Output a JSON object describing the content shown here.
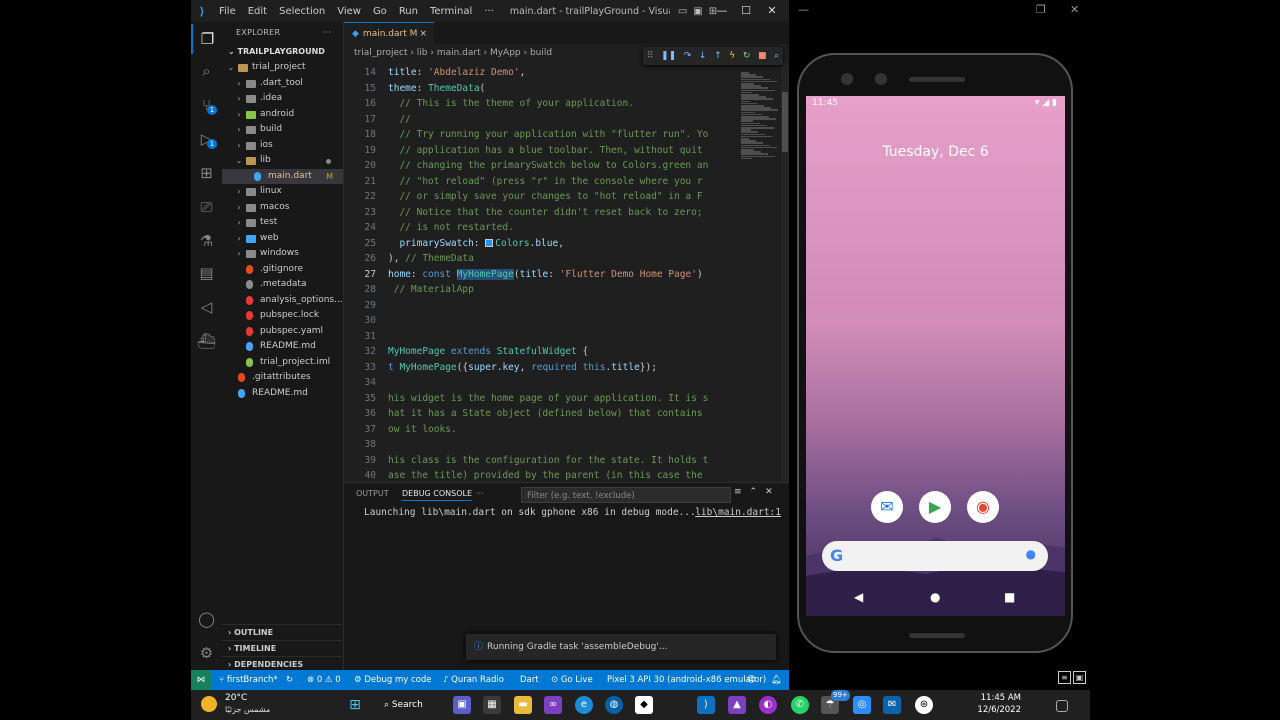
{
  "vscode": {
    "menu": [
      "File",
      "Edit",
      "Selection",
      "View",
      "Go",
      "Run",
      "Terminal",
      "···"
    ],
    "window_title": "main.dart - trailPlayGround - Visual Studi...",
    "explorer_title": "EXPLORER",
    "explorer_more": "···",
    "workspace": "TRAILPLAYGROUND",
    "tree": [
      {
        "label": "trial_project",
        "depth": 1,
        "chev": "⌄",
        "color": "#c09553",
        "kind": "folder"
      },
      {
        "label": ".dart_tool",
        "depth": 2,
        "chev": "›",
        "color": "#8a8a8a",
        "kind": "folder"
      },
      {
        "label": ".idea",
        "depth": 2,
        "chev": "›",
        "color": "#8a8a8a",
        "kind": "folder"
      },
      {
        "label": "android",
        "depth": 2,
        "chev": "›",
        "color": "#8bc34a",
        "kind": "folder"
      },
      {
        "label": "build",
        "depth": 2,
        "chev": "›",
        "color": "#8a8a8a",
        "kind": "folder"
      },
      {
        "label": "ios",
        "depth": 2,
        "chev": "›",
        "color": "#8a8a8a",
        "kind": "folder"
      },
      {
        "label": "lib",
        "depth": 2,
        "chev": "⌄",
        "color": "#c09553",
        "kind": "folder",
        "dot": true
      },
      {
        "label": "main.dart",
        "depth": 3,
        "chev": "",
        "color": "#42a5f5",
        "kind": "file",
        "mod": "M",
        "selected": true
      },
      {
        "label": "linux",
        "depth": 2,
        "chev": "›",
        "color": "#8a8a8a",
        "kind": "folder"
      },
      {
        "label": "macos",
        "depth": 2,
        "chev": "›",
        "color": "#8a8a8a",
        "kind": "folder"
      },
      {
        "label": "test",
        "depth": 2,
        "chev": "›",
        "color": "#8a8a8a",
        "kind": "folder"
      },
      {
        "label": "web",
        "depth": 2,
        "chev": "›",
        "color": "#42a5f5",
        "kind": "folder"
      },
      {
        "label": "windows",
        "depth": 2,
        "chev": "›",
        "color": "#8a8a8a",
        "kind": "folder"
      },
      {
        "label": ".gitignore",
        "depth": 2,
        "chev": "",
        "color": "#e64a19",
        "kind": "file"
      },
      {
        "label": ".metadata",
        "depth": 2,
        "chev": "",
        "color": "#8a8a8a",
        "kind": "file"
      },
      {
        "label": "analysis_options...",
        "depth": 2,
        "chev": "",
        "color": "#e53935",
        "kind": "file"
      },
      {
        "label": "pubspec.lock",
        "depth": 2,
        "chev": "",
        "color": "#e53935",
        "kind": "file"
      },
      {
        "label": "pubspec.yaml",
        "depth": 2,
        "chev": "",
        "color": "#e53935",
        "kind": "file"
      },
      {
        "label": "README.md",
        "depth": 2,
        "chev": "",
        "color": "#42a5f5",
        "kind": "file"
      },
      {
        "label": "trial_project.iml",
        "depth": 2,
        "chev": "",
        "color": "#8bc34a",
        "kind": "file"
      },
      {
        "label": ".gitattributes",
        "depth": 1,
        "chev": "",
        "color": "#e64a19",
        "kind": "file"
      },
      {
        "label": "README.md",
        "depth": 1,
        "chev": "",
        "color": "#42a5f5",
        "kind": "file"
      }
    ],
    "sections": [
      "OUTLINE",
      "TIMELINE",
      "DEPENDENCIES"
    ],
    "tab": {
      "label": "main.dart",
      "modified": "M",
      "close": "×"
    },
    "breadcrumb": "trial_project › lib › main.dart › MyApp › build",
    "code_lines": [
      {
        "n": 14,
        "tokens": [
          [
            "t-prop",
            "title"
          ],
          [
            "t-plain",
            ": "
          ],
          [
            "t-str",
            "'Abdelaziz Demo'"
          ],
          [
            "t-plain",
            ","
          ]
        ]
      },
      {
        "n": 15,
        "tokens": [
          [
            "t-prop",
            "theme"
          ],
          [
            "t-plain",
            ": "
          ],
          [
            "t-cls",
            "ThemeData"
          ],
          [
            "t-plain",
            "("
          ]
        ]
      },
      {
        "n": 16,
        "tokens": [
          [
            "t-com",
            "  // This is the theme of your application."
          ]
        ]
      },
      {
        "n": 17,
        "tokens": [
          [
            "t-com",
            "  //"
          ]
        ]
      },
      {
        "n": 18,
        "tokens": [
          [
            "t-com",
            "  // Try running your application with \"flutter run\". Yo"
          ]
        ]
      },
      {
        "n": 19,
        "tokens": [
          [
            "t-com",
            "  // application has a blue toolbar. Then, without quit"
          ]
        ]
      },
      {
        "n": 20,
        "tokens": [
          [
            "t-com",
            "  // changing the primarySwatch below to Colors.green an"
          ]
        ]
      },
      {
        "n": 21,
        "tokens": [
          [
            "t-com",
            "  // \"hot reload\" (press \"r\" in the console where you r"
          ]
        ]
      },
      {
        "n": 22,
        "tokens": [
          [
            "t-com",
            "  // or simply save your changes to \"hot reload\" in a F"
          ]
        ]
      },
      {
        "n": 23,
        "tokens": [
          [
            "t-com",
            "  // Notice that the counter didn't reset back to zero;"
          ]
        ]
      },
      {
        "n": 24,
        "tokens": [
          [
            "t-com",
            "  // is not restarted."
          ]
        ]
      },
      {
        "n": 25,
        "tokens": [
          [
            "t-prop",
            "  primarySwatch"
          ],
          [
            "t-plain",
            ": "
          ],
          [
            "swatch",
            ""
          ],
          [
            "t-cls",
            "Colors"
          ],
          [
            "t-plain",
            "."
          ],
          [
            "t-prop",
            "blue"
          ],
          [
            "t-plain",
            ","
          ]
        ]
      },
      {
        "n": 26,
        "tokens": [
          [
            "t-plain",
            "), "
          ],
          [
            "t-com",
            "// ThemeData"
          ]
        ]
      },
      {
        "n": 27,
        "cur": true,
        "tokens": [
          [
            "t-prop",
            "home"
          ],
          [
            "t-plain",
            ": "
          ],
          [
            "t-kw",
            "const "
          ],
          [
            "t-hl",
            "MyHomePage"
          ],
          [
            "t-plain",
            "("
          ],
          [
            "t-prop",
            "title"
          ],
          [
            "t-plain",
            ": "
          ],
          [
            "t-str",
            "'Flutter Demo Home Page'"
          ],
          [
            "t-plain",
            ")"
          ]
        ]
      },
      {
        "n": 28,
        "tokens": [
          [
            "t-com",
            " // MaterialApp"
          ]
        ]
      },
      {
        "n": 29,
        "tokens": []
      },
      {
        "n": 30,
        "tokens": []
      },
      {
        "n": 31,
        "tokens": []
      },
      {
        "n": 32,
        "tokens": [
          [
            "t-cls",
            "MyHomePage"
          ],
          [
            "t-kw",
            " extends "
          ],
          [
            "t-cls",
            "StatefulWidget"
          ],
          [
            "t-plain",
            " {"
          ]
        ]
      },
      {
        "n": 33,
        "tokens": [
          [
            "t-kw",
            "t "
          ],
          [
            "t-cls",
            "MyHomePage"
          ],
          [
            "t-plain",
            "({"
          ],
          [
            "t-prop",
            "super"
          ],
          [
            "t-plain",
            "."
          ],
          [
            "t-prop",
            "key"
          ],
          [
            "t-plain",
            ", "
          ],
          [
            "t-kw",
            "required "
          ],
          [
            "t-kw",
            "this"
          ],
          [
            "t-plain",
            "."
          ],
          [
            "t-prop",
            "title"
          ],
          [
            "t-plain",
            "});"
          ]
        ]
      },
      {
        "n": 34,
        "tokens": []
      },
      {
        "n": 35,
        "tokens": [
          [
            "t-com",
            "his widget is the home page of your application. It is s"
          ]
        ]
      },
      {
        "n": 36,
        "tokens": [
          [
            "t-com",
            "hat it has a State object (defined below) that contains"
          ]
        ]
      },
      {
        "n": 37,
        "tokens": [
          [
            "t-com",
            "ow it looks."
          ]
        ]
      },
      {
        "n": 38,
        "tokens": []
      },
      {
        "n": 39,
        "tokens": [
          [
            "t-com",
            "his class is the configuration for the state. It holds t"
          ]
        ]
      },
      {
        "n": 40,
        "tokens": [
          [
            "t-com",
            "ase the title) provided by the parent (in this case the"
          ]
        ]
      }
    ],
    "panel": {
      "tabs": [
        "OUTPUT",
        "DEBUG CONSOLE",
        "···"
      ],
      "filter_placeholder": "Filter (e.g. text, !exclude)",
      "log": "Launching lib\\main.dart on sdk gphone x86 in debug mode...",
      "log_link": "lib\\main.dart:1"
    },
    "notification": "Running Gradle task 'assembleDebug'...",
    "status": {
      "branch": "firstBranch*",
      "errors": "⊗ 0 ⚠ 0",
      "debug": "Debug my code",
      "radio": "Quran Radio",
      "lang": "Dart",
      "golive": "Go Live",
      "device": "Pixel 3 API 30 (android-x86 emulator)"
    }
  },
  "emulator": {
    "time": "11:45",
    "date": "Tuesday, Dec 6"
  },
  "taskbar": {
    "temp": "20°C",
    "location": "مشمس جزئيًا",
    "search": "Search",
    "time": "11:45 AM",
    "date": "12/6/2022",
    "badge": "99+"
  }
}
